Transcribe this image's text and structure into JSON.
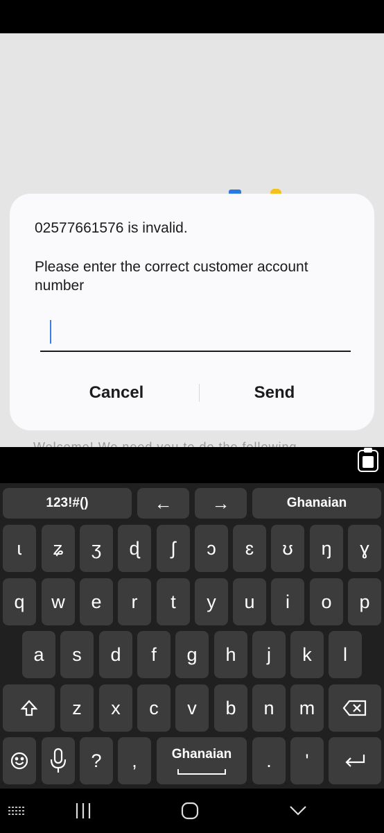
{
  "dialog": {
    "message_line1": "02577661576 is invalid.",
    "message_line2": "Please enter the correct customer account number",
    "input_value": "",
    "cancel_label": "Cancel",
    "send_label": "Send"
  },
  "background": {
    "partial_text": "Welcome! We need you to do the following"
  },
  "keyboard": {
    "top_row": {
      "symbols": "123!#()",
      "left_arrow": "←",
      "right_arrow": "→",
      "language": "Ghanaian"
    },
    "row_special": [
      "ɩ",
      "ʑ",
      "ʒ",
      "ɖ",
      "ʃ",
      "ɔ",
      "ɛ",
      "ʊ",
      "ŋ",
      "ɣ"
    ],
    "row1": [
      "q",
      "w",
      "e",
      "r",
      "t",
      "y",
      "u",
      "i",
      "o",
      "p"
    ],
    "row2": [
      "a",
      "s",
      "d",
      "f",
      "g",
      "h",
      "j",
      "k",
      "l"
    ],
    "row3": [
      "z",
      "x",
      "c",
      "v",
      "b",
      "n",
      "m"
    ],
    "bottom_row": {
      "question": "?",
      "comma": ",",
      "space_label": "Ghanaian",
      "period": ".",
      "apostrophe": "'"
    }
  },
  "icons": {
    "clipboard": "clipboard-icon",
    "shift": "shift-icon",
    "backspace": "backspace-icon",
    "emoji": "emoji-icon",
    "mic": "mic-icon",
    "enter": "enter-icon",
    "keyboard_toggle": "keyboard-icon",
    "recents": "recents-icon",
    "home": "home-icon",
    "back": "back-icon"
  },
  "colors": {
    "caret": "#3b7ee8",
    "keyboard_bg": "#202020",
    "key_bg": "#3c3c3c"
  }
}
